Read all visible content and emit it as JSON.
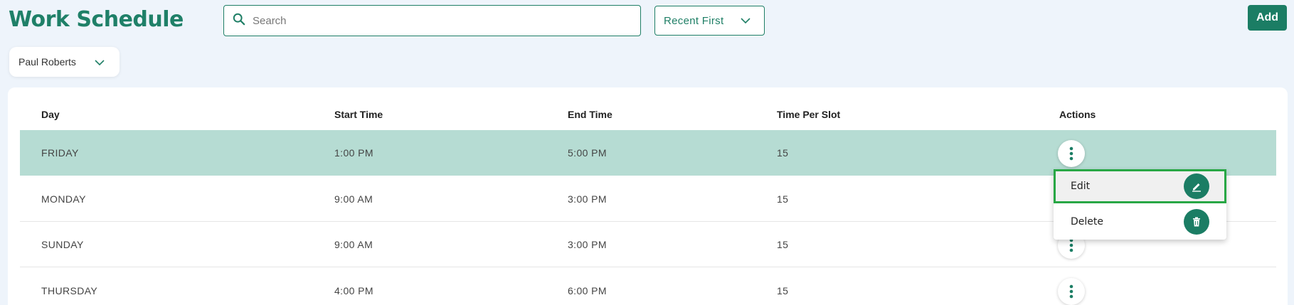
{
  "header": {
    "title": "Work Schedule",
    "search_placeholder": "Search",
    "sort_value": "Recent First",
    "add_label": "Add"
  },
  "filter": {
    "user_value": "Paul Roberts"
  },
  "table": {
    "columns": [
      "Day",
      "Start Time",
      "End Time",
      "Time Per Slot",
      "Actions"
    ],
    "rows": [
      {
        "day": "FRIDAY",
        "start": "1:00 PM",
        "end": "5:00 PM",
        "slot": "15"
      },
      {
        "day": "MONDAY",
        "start": "9:00 AM",
        "end": "3:00 PM",
        "slot": "15"
      },
      {
        "day": "SUNDAY",
        "start": "9:00 AM",
        "end": "3:00 PM",
        "slot": "15"
      },
      {
        "day": "THURSDAY",
        "start": "4:00 PM",
        "end": "6:00 PM",
        "slot": "15"
      }
    ]
  },
  "action_menu": {
    "edit_label": "Edit",
    "delete_label": "Delete"
  },
  "colors": {
    "accent": "#1b7d64",
    "selected_row": "#b6dcd3",
    "highlight_border": "#28a745",
    "background": "#eef4fb"
  },
  "icons": {
    "search": "search-icon",
    "chevron": "chevron-down-icon",
    "kebab": "more-vertical-icon",
    "edit": "pencil-icon",
    "delete": "trash-icon"
  }
}
